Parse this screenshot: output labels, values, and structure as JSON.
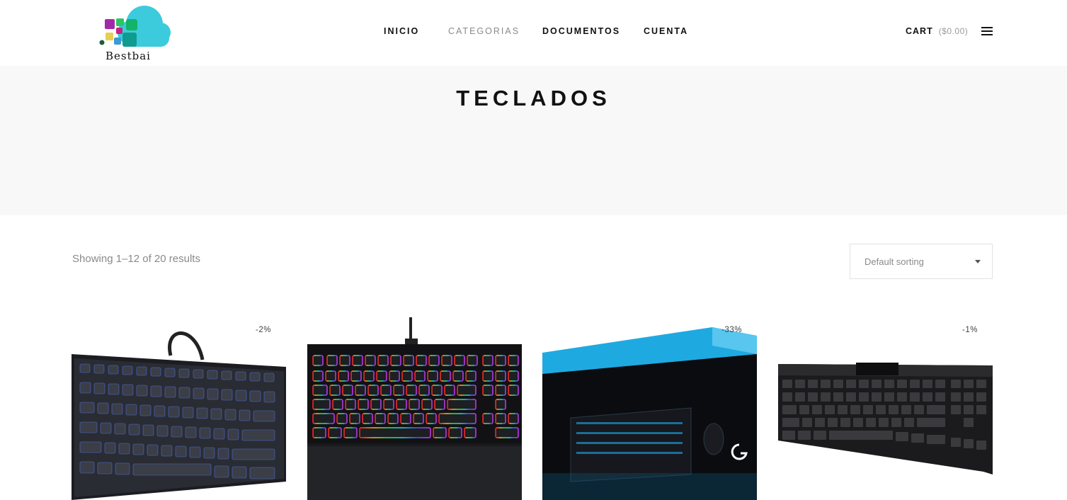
{
  "header": {
    "logo_text": "Bestbai",
    "nav": [
      {
        "label": "INICIO"
      },
      {
        "label": "CATEGORIAS"
      },
      {
        "label": "DOCUMENTOS"
      },
      {
        "label": "CUENTA"
      }
    ],
    "cart_label": "CART",
    "cart_total": "($0.00)",
    "menu_icon": "hamburger-menu-icon"
  },
  "hero": {
    "title": "TECLADOS"
  },
  "toolbar": {
    "results_text": "Showing 1–12 of 20 results",
    "sort_selected": "Default sorting"
  },
  "products": [
    {
      "badge": "-2%",
      "image": "mechanical-keyboard-blue-backlit"
    },
    {
      "badge": "",
      "image": "rgb-keyboard-wrist-rest"
    },
    {
      "badge": "-33%",
      "image": "gear-up-bundle-box"
    },
    {
      "badge": "-1%",
      "image": "black-mechanical-keyboard"
    }
  ],
  "colors": {
    "hero_bg": "#f8f8f8",
    "text": "#111111",
    "muted": "#8a8a8a",
    "bundle_blue": "#1fa9e1"
  }
}
